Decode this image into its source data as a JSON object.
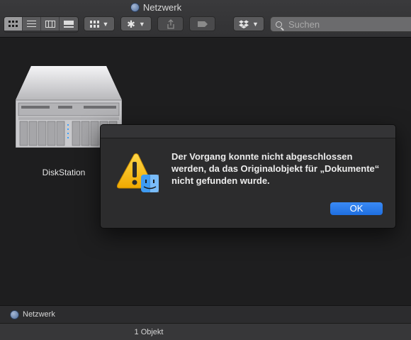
{
  "window": {
    "title": "Netzwerk"
  },
  "toolbar": {
    "view_modes": [
      {
        "name": "icon-view",
        "icon": "grid-icon",
        "active": true
      },
      {
        "name": "list-view",
        "icon": "list-icon",
        "active": false
      },
      {
        "name": "column-view",
        "icon": "columns-icon",
        "active": false
      },
      {
        "name": "gallery-view",
        "icon": "gallery-icon",
        "active": false
      }
    ],
    "group_icon": "group-grid-icon",
    "action_icon": "gear-icon",
    "share_icon": "share-icon",
    "tag_icon": "tag-icon",
    "dropbox_icon": "dropbox-icon",
    "search": {
      "placeholder": "Suchen",
      "value": ""
    }
  },
  "content": {
    "items": [
      {
        "label": "DiskStation",
        "icon": "server-icon"
      }
    ]
  },
  "dialog": {
    "message": "Der Vorgang konnte nicht abgeschlossen werden, da das Originalobjekt für „Dokumente“ nicht gefunden wurde.",
    "ok_label": "OK",
    "icon": "warning-finder-icon"
  },
  "pathbar": {
    "label": "Netzwerk"
  },
  "statusbar": {
    "text": "1 Objekt"
  },
  "colors": {
    "accent": "#1f6fe0",
    "warning": "#f5b400",
    "background": "#1e1e1f"
  }
}
